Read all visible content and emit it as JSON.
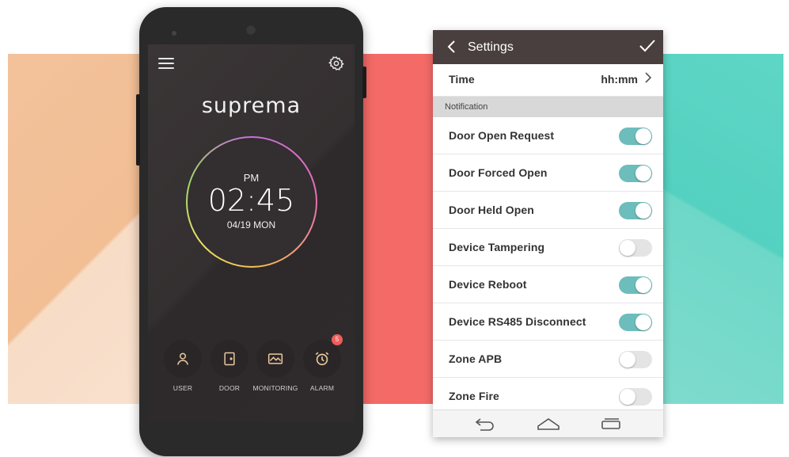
{
  "phone": {
    "logo": "suprema",
    "clock": {
      "ampm": "PM",
      "time": "02:45",
      "date": "04/19 MON"
    },
    "nav": [
      {
        "label": "USER",
        "icon": "user-icon"
      },
      {
        "label": "DOOR",
        "icon": "door-icon"
      },
      {
        "label": "MONITORING",
        "icon": "monitoring-icon"
      },
      {
        "label": "ALARM",
        "icon": "alarm-clock-icon",
        "badge": "5"
      }
    ]
  },
  "settings": {
    "title": "Settings",
    "time_row": {
      "label": "Time",
      "value": "hh:mm"
    },
    "section": "Notification",
    "items": [
      {
        "label": "Door Open Request",
        "on": true
      },
      {
        "label": "Door Forced Open",
        "on": true
      },
      {
        "label": "Door Held Open",
        "on": true
      },
      {
        "label": "Device Tampering",
        "on": false
      },
      {
        "label": "Device Reboot",
        "on": true
      },
      {
        "label": "Device RS485 Disconnect",
        "on": true
      },
      {
        "label": "Zone APB",
        "on": false
      },
      {
        "label": "Zone Fire",
        "on": false
      }
    ]
  },
  "colors": {
    "toggle_on": "#6cbdbb",
    "toggle_off": "#e4e4e4",
    "header": "#4a3f3f",
    "badge": "#ef5e5b"
  }
}
